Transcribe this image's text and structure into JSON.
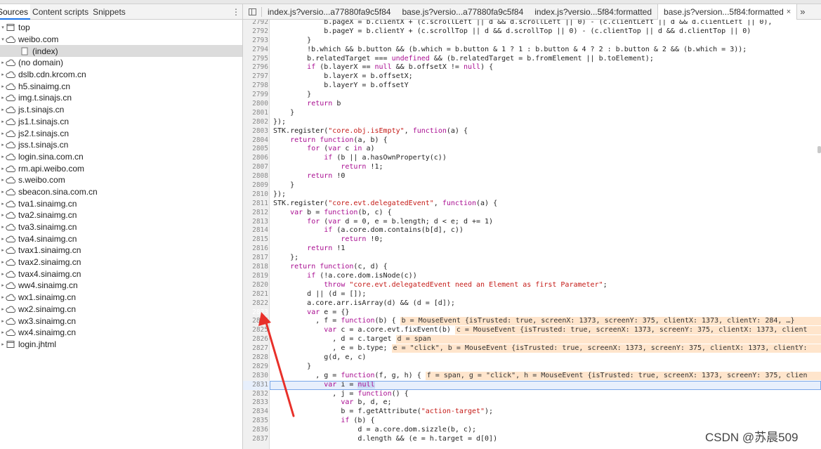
{
  "left_panel": {
    "tabs": [
      "Sources",
      "Content scripts",
      "Snippets"
    ],
    "more": "⋮",
    "tree": [
      {
        "label": "top",
        "type": "frame",
        "indent": 0,
        "expanded": true
      },
      {
        "label": "weibo.com",
        "type": "cloud",
        "indent": 0,
        "expanded": true
      },
      {
        "label": "(index)",
        "type": "file",
        "indent": 1,
        "selected": true
      },
      {
        "label": "(no domain)",
        "type": "cloud",
        "indent": 0
      },
      {
        "label": "dslb.cdn.krcom.cn",
        "type": "cloud",
        "indent": 0
      },
      {
        "label": "h5.sinaimg.cn",
        "type": "cloud",
        "indent": 0
      },
      {
        "label": "img.t.sinajs.cn",
        "type": "cloud",
        "indent": 0
      },
      {
        "label": "js.t.sinajs.cn",
        "type": "cloud",
        "indent": 0
      },
      {
        "label": "js1.t.sinajs.cn",
        "type": "cloud",
        "indent": 0
      },
      {
        "label": "js2.t.sinajs.cn",
        "type": "cloud",
        "indent": 0
      },
      {
        "label": "jss.t.sinajs.cn",
        "type": "cloud",
        "indent": 0
      },
      {
        "label": "login.sina.com.cn",
        "type": "cloud",
        "indent": 0
      },
      {
        "label": "rm.api.weibo.com",
        "type": "cloud",
        "indent": 0
      },
      {
        "label": "s.weibo.com",
        "type": "cloud",
        "indent": 0
      },
      {
        "label": "sbeacon.sina.com.cn",
        "type": "cloud",
        "indent": 0
      },
      {
        "label": "tva1.sinaimg.cn",
        "type": "cloud",
        "indent": 0
      },
      {
        "label": "tva2.sinaimg.cn",
        "type": "cloud",
        "indent": 0
      },
      {
        "label": "tva3.sinaimg.cn",
        "type": "cloud",
        "indent": 0
      },
      {
        "label": "tva4.sinaimg.cn",
        "type": "cloud",
        "indent": 0
      },
      {
        "label": "tvax1.sinaimg.cn",
        "type": "cloud",
        "indent": 0
      },
      {
        "label": "tvax2.sinaimg.cn",
        "type": "cloud",
        "indent": 0
      },
      {
        "label": "tvax4.sinaimg.cn",
        "type": "cloud",
        "indent": 0
      },
      {
        "label": "ww4.sinaimg.cn",
        "type": "cloud",
        "indent": 0
      },
      {
        "label": "wx1.sinaimg.cn",
        "type": "cloud",
        "indent": 0
      },
      {
        "label": "wx2.sinaimg.cn",
        "type": "cloud",
        "indent": 0
      },
      {
        "label": "wx3.sinaimg.cn",
        "type": "cloud",
        "indent": 0
      },
      {
        "label": "wx4.sinaimg.cn",
        "type": "cloud",
        "indent": 0
      },
      {
        "label": "login.jhtml",
        "type": "frame",
        "indent": 0
      }
    ]
  },
  "file_tabs": [
    {
      "label": "index.js?versio...a77880fa9c5f84"
    },
    {
      "label": "base.js?versio...a77880fa9c5f84"
    },
    {
      "label": "index.js?versio...5f84:formatted"
    },
    {
      "label": "base.js?version...5f84:formatted",
      "active": true,
      "close": "×"
    }
  ],
  "file_tabs_more": "»",
  "code_lines": [
    {
      "n": "2792",
      "t": "            b.pageX = b.clientX + (c.scrollLeft || d && d.scrollLeft || 0) - (c.clientLeft || d && d.clientLeft || 0),"
    },
    {
      "n": "2792",
      "t": "            b.pageY = b.clientY + (c.scrollTop || d && d.scrollTop || 0) - (c.clientTop || d && d.clientTop || 0)"
    },
    {
      "n": "2793",
      "t": "        }"
    },
    {
      "n": "2794",
      "t": "        !b.which && b.button && (b.which = b.button & 1 ? 1 : b.button & 4 ? 2 : b.button & 2 && (b.which = 3));"
    },
    {
      "n": "2795",
      "t": "        b.relatedTarget === undefined && (b.relatedTarget = b.fromElement || b.toElement);"
    },
    {
      "n": "2796",
      "t": "        if (b.layerX == null && b.offsetX != null) {"
    },
    {
      "n": "2797",
      "t": "            b.layerX = b.offsetX;"
    },
    {
      "n": "2798",
      "t": "            b.layerY = b.offsetY"
    },
    {
      "n": "2799",
      "t": "        }"
    },
    {
      "n": "2800",
      "t": "        return b"
    },
    {
      "n": "2801",
      "t": "    }"
    },
    {
      "n": "2802",
      "t": "});"
    },
    {
      "n": "2803",
      "t": "STK.register(\"core.obj.isEmpty\", function(a) {"
    },
    {
      "n": "2804",
      "t": "    return function(a, b) {"
    },
    {
      "n": "2805",
      "t": "        for (var c in a)"
    },
    {
      "n": "2806",
      "t": "            if (b || a.hasOwnProperty(c))"
    },
    {
      "n": "2807",
      "t": "                return !1;"
    },
    {
      "n": "2808",
      "t": "        return !0"
    },
    {
      "n": "2809",
      "t": "    }"
    },
    {
      "n": "2810",
      "t": "});"
    },
    {
      "n": "2811",
      "t": "STK.register(\"core.evt.delegatedEvent\", function(a) {"
    },
    {
      "n": "2812",
      "t": "    var b = function(b, c) {"
    },
    {
      "n": "2813",
      "t": "        for (var d = 0, e = b.length; d < e; d += 1)"
    },
    {
      "n": "2814",
      "t": "            if (a.core.dom.contains(b[d], c))"
    },
    {
      "n": "2815",
      "t": "                return !0;"
    },
    {
      "n": "2816",
      "t": "        return !1"
    },
    {
      "n": "2817",
      "t": "    };"
    },
    {
      "n": "2818",
      "t": "    return function(c, d) {"
    },
    {
      "n": "2819",
      "t": "        if (!a.core.dom.isNode(c))"
    },
    {
      "n": "2820",
      "t": "            throw \"core.evt.delegatedEvent need an Element as first Parameter\";"
    },
    {
      "n": "2821",
      "t": "        d || (d = []);"
    },
    {
      "n": "2822",
      "t": "        a.core.arr.isArray(d) && (d = [d]);"
    },
    {
      "n": "2823",
      "t": "        var e = {}",
      "bp": true
    },
    {
      "n": "2824",
      "t": "          , f = function(b) {",
      "val": "b = MouseEvent {isTrusted: true, screenX: 1373, screenY: 375, clientX: 1373, clientY: 284, …}"
    },
    {
      "n": "2825",
      "t": "            var c = a.core.evt.fixEvent(b)",
      "val": "c = MouseEvent {isTrusted: true, screenX: 1373, screenY: 375, clientX: 1373, client"
    },
    {
      "n": "2826",
      "t": "              , d = c.target",
      "val": "d = span"
    },
    {
      "n": "2827",
      "t": "              , e = b.type;",
      "val": "e = \"click\", b = MouseEvent {isTrusted: true, screenX: 1373, screenY: 375, clientX: 1373, clientY:"
    },
    {
      "n": "2828",
      "t": "            g(d, e, c)"
    },
    {
      "n": "2829",
      "t": "        }"
    },
    {
      "n": "2830",
      "t": "          , g = function(f, g, h) {",
      "val": "f = span, g = \"click\", h = MouseEvent {isTrusted: true, screenX: 1373, screenY: 375, clien"
    },
    {
      "n": "2831",
      "t": "            var i = null",
      "cur": true
    },
    {
      "n": "2832",
      "t": "              , j = function() {"
    },
    {
      "n": "2833",
      "t": "                var b, d, e;"
    },
    {
      "n": "2834",
      "t": "                b = f.getAttribute(\"action-target\");"
    },
    {
      "n": "2835",
      "t": "                if (b) {"
    },
    {
      "n": "2836",
      "t": "                    d = a.core.dom.sizzle(b, c);"
    },
    {
      "n": "2837",
      "t": "                    d.length && (e = h.target = d[0])"
    }
  ],
  "watermark": "CSDN @苏晨509",
  "colors": {
    "breakpoint": "#3b7ce5",
    "inline_value_bg": "#ffe5cc",
    "arrow": "#e8302a",
    "current_line": "#e7effc"
  }
}
